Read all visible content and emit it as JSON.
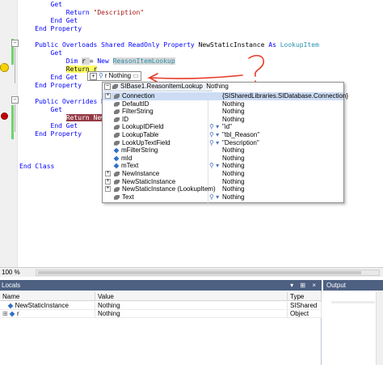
{
  "editor": {
    "lines": [
      {
        "indent": "        ",
        "parts": [
          {
            "t": "Get",
            "c": "kw"
          }
        ]
      },
      {
        "indent": "            ",
        "parts": [
          {
            "t": "Return ",
            "c": "kw"
          },
          {
            "t": "\"Description\"",
            "c": "str"
          }
        ]
      },
      {
        "indent": "        ",
        "parts": [
          {
            "t": "End Get",
            "c": "kw"
          }
        ]
      },
      {
        "indent": "    ",
        "parts": [
          {
            "t": "End Property",
            "c": "kw"
          }
        ]
      },
      {
        "indent": "",
        "parts": []
      },
      {
        "indent": "    ",
        "parts": [
          {
            "t": "Public Overloads Shared ReadOnly Property ",
            "c": "kw"
          },
          {
            "t": "NewStaticInstance ",
            "c": ""
          },
          {
            "t": "As ",
            "c": "kw"
          },
          {
            "t": "LookupItem",
            "c": "typ"
          }
        ]
      },
      {
        "indent": "        ",
        "parts": [
          {
            "t": "Get",
            "c": "kw"
          }
        ]
      },
      {
        "indent": "            ",
        "parts": [
          {
            "t": "Dim ",
            "c": "kw"
          },
          {
            "t": "r ",
            "c": "sel-gray"
          },
          {
            "t": "= ",
            "c": ""
          },
          {
            "t": "New ",
            "c": "kw"
          },
          {
            "t": "ReasonItemLookup",
            "c": "typ sel-gray"
          }
        ]
      },
      {
        "indent": "            ",
        "parts": [
          {
            "t": "Return r",
            "c": "hl-yellow"
          }
        ]
      },
      {
        "indent": "        ",
        "parts": [
          {
            "t": "End Get",
            "c": "kw"
          }
        ]
      },
      {
        "indent": "    ",
        "parts": [
          {
            "t": "End Property",
            "c": "kw"
          }
        ]
      },
      {
        "indent": "",
        "parts": []
      },
      {
        "indent": "    ",
        "parts": [
          {
            "t": "Public Overrides Read",
            "c": "kw"
          }
        ]
      },
      {
        "indent": "        ",
        "parts": [
          {
            "t": "Get",
            "c": "kw"
          }
        ]
      },
      {
        "indent": "            ",
        "parts": [
          {
            "t": "Return NewSta",
            "c": "hl-red"
          }
        ]
      },
      {
        "indent": "        ",
        "parts": [
          {
            "t": "End Get",
            "c": "kw"
          }
        ]
      },
      {
        "indent": "    ",
        "parts": [
          {
            "t": "End Property",
            "c": "kw"
          }
        ]
      },
      {
        "indent": "",
        "parts": []
      },
      {
        "indent": "",
        "parts": []
      },
      {
        "indent": "",
        "parts": []
      },
      {
        "indent": "",
        "parts": [
          {
            "t": "End Class",
            "c": "kw"
          }
        ]
      }
    ]
  },
  "datatip": {
    "expander": "+",
    "var_name": "r",
    "value": "Nothing"
  },
  "popup": {
    "header": "SIBase1.ReasonItemLookup",
    "header_value": "Nothing",
    "rows": [
      {
        "name": "Connection",
        "icon": "prop",
        "expandable": true,
        "value": "{SISharedLibraries.SIDatabase.Connection}",
        "mag": false,
        "selected": true
      },
      {
        "name": "DefaultID",
        "icon": "prop",
        "expandable": false,
        "value": "Nothing",
        "mag": false,
        "selected": false
      },
      {
        "name": "FilterString",
        "icon": "prop",
        "expandable": false,
        "value": "Nothing",
        "mag": false,
        "selected": false
      },
      {
        "name": "ID",
        "icon": "prop",
        "expandable": false,
        "value": "Nothing",
        "mag": false,
        "selected": false
      },
      {
        "name": "LookupIDField",
        "icon": "prop",
        "expandable": false,
        "value": "\"id\"",
        "mag": true,
        "selected": false
      },
      {
        "name": "LookupTable",
        "icon": "prop",
        "expandable": false,
        "value": "\"tbl_Reason\"",
        "mag": true,
        "selected": false
      },
      {
        "name": "LookUpTextField",
        "icon": "prop",
        "expandable": false,
        "value": "\"Description\"",
        "mag": true,
        "selected": false
      },
      {
        "name": "mFilterString",
        "icon": "field",
        "expandable": false,
        "value": "Nothing",
        "mag": false,
        "selected": false
      },
      {
        "name": "mId",
        "icon": "field",
        "expandable": false,
        "value": "Nothing",
        "mag": false,
        "selected": false
      },
      {
        "name": "mText",
        "icon": "field",
        "expandable": false,
        "value": "Nothing",
        "mag": true,
        "selected": false
      },
      {
        "name": "NewInstance",
        "icon": "prop",
        "expandable": true,
        "value": "Nothing",
        "mag": false,
        "selected": false
      },
      {
        "name": "NewStaticInstance",
        "icon": "prop",
        "expandable": true,
        "value": "Nothing",
        "mag": false,
        "selected": false
      },
      {
        "name": "NewStaticInstance (LookupItem)",
        "icon": "prop",
        "expandable": true,
        "value": "Nothing",
        "mag": false,
        "selected": false
      },
      {
        "name": "Text",
        "icon": "prop",
        "expandable": false,
        "value": "Nothing",
        "mag": true,
        "selected": false
      }
    ]
  },
  "zoom": {
    "label": "100 %"
  },
  "locals": {
    "title": "Locals",
    "buttons": "▾ ⊞ ×",
    "columns": [
      "Name",
      "Value",
      "Type"
    ],
    "rows": [
      {
        "name": "NewStaticInstance",
        "value": "Nothing",
        "type": "SIShared",
        "expandable": false
      },
      {
        "name": "r",
        "value": "Nothing",
        "type": "Object",
        "expandable": true
      }
    ]
  },
  "output": {
    "title": "Output"
  },
  "colors": {
    "title_bar": "#4d6082",
    "keyword": "#0000ff",
    "string": "#a31515",
    "type": "#2b91af",
    "current_line": "#ffff66",
    "breakpoint_line": "#963a46",
    "annotation": "#e83a2a"
  }
}
